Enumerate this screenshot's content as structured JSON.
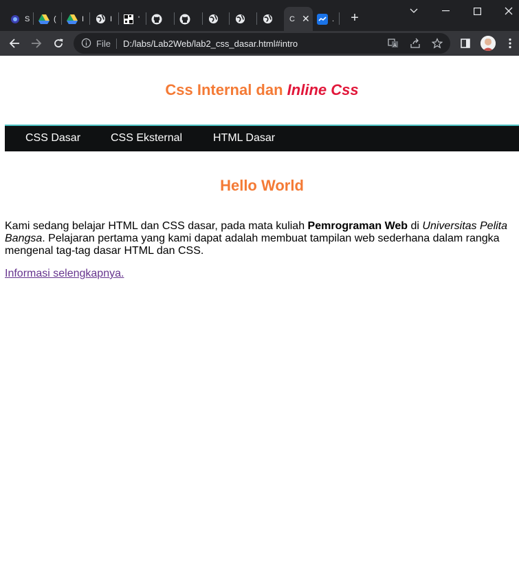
{
  "browser": {
    "tabs": [
      {
        "icon": "app-icon",
        "title": "S"
      },
      {
        "icon": "google-drive-icon",
        "title": "("
      },
      {
        "icon": "google-drive-icon",
        "title": "I"
      },
      {
        "icon": "globe-icon",
        "title": "I"
      },
      {
        "icon": "qr-icon",
        "title": "'"
      },
      {
        "icon": "github-icon",
        "title": ""
      },
      {
        "icon": "github-icon",
        "title": ""
      },
      {
        "icon": "globe-icon",
        "title": ""
      },
      {
        "icon": "globe-icon",
        "title": ""
      },
      {
        "icon": "globe-icon",
        "title": ""
      },
      {
        "icon": "page-icon",
        "title": "C",
        "active": true
      },
      {
        "icon": "chart-icon",
        "title": "."
      }
    ],
    "new_tab_label": "+",
    "address": {
      "scheme_label": "File",
      "url": "D:/labs/Lab2Web/lab2_css_dasar.html#intro"
    }
  },
  "page": {
    "title_main": "Css Internal dan ",
    "title_italic": "Inline Css",
    "nav": [
      "CSS Dasar",
      "CSS Eksternal",
      "HTML Dasar"
    ],
    "heading": "Hello World",
    "paragraph": {
      "p1": "Kami sedang belajar HTML dan CSS dasar, pada mata kuliah ",
      "bold": "Pemrograman Web",
      "p2": " di ",
      "italic": "Universitas Pelita Bangsa",
      "p3": ". Pelajaran pertama yang kami dapat adalah membuat tampilan web sederhana dalam rangka mengenal tag-tag dasar HTML dan CSS."
    },
    "link_text": "Informasi selengkapnya."
  },
  "colors": {
    "accent_orange": "#f47a35",
    "accent_red": "#e1173a",
    "nav_bg": "#0f1112",
    "nav_border": "#4dc3c4",
    "link_visited": "#66348e"
  }
}
